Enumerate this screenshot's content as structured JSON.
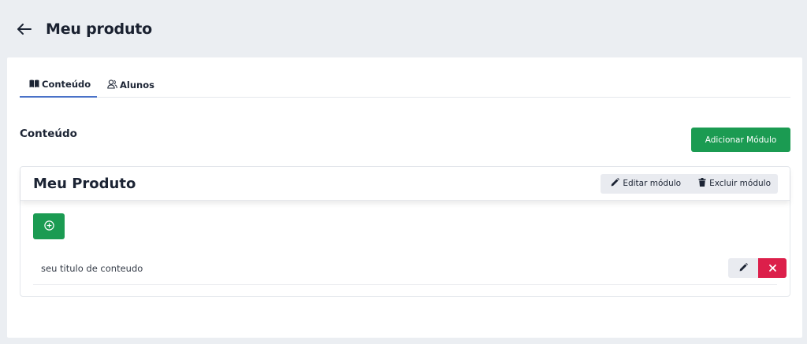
{
  "header": {
    "title": "Meu produto",
    "back_icon": "arrow-left-icon"
  },
  "tabs": [
    {
      "label": "Conteúdo",
      "icon": "book-open-icon",
      "active": true
    },
    {
      "label": "Alunos",
      "icon": "users-icon",
      "active": false
    }
  ],
  "content_section": {
    "title": "Conteúdo",
    "add_module_label": "Adicionar Módulo"
  },
  "module": {
    "title": "Meu Produto",
    "edit_label": "Editar módulo",
    "delete_label": "Excluir módulo",
    "add_content_icon": "plus-circle-icon",
    "items": [
      {
        "title": "seu titulo de conteudo"
      }
    ]
  },
  "colors": {
    "background": "#ebeef2",
    "primary_green": "#1b9b52",
    "danger_red": "#dc1f4a",
    "tab_active": "#4a72c8",
    "action_gray": "#e9ebf0"
  }
}
